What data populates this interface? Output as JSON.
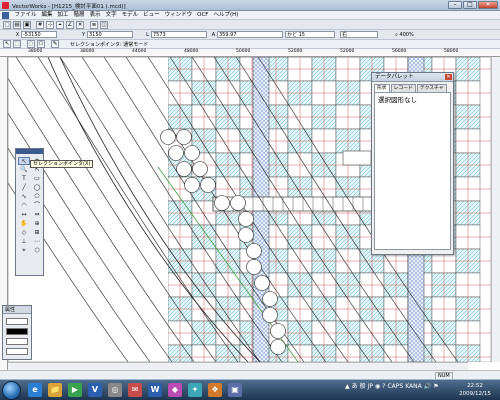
{
  "window": {
    "title": "VectorWorks - [H1215_検討平面01 (.mcd)]"
  },
  "menu": {
    "items": [
      "ファイル",
      "編集",
      "加工",
      "階層",
      "表示",
      "文字",
      "モデル",
      "ビュー",
      "ウィンドウ",
      "OCF",
      "ヘルプ(H)"
    ]
  },
  "coords": {
    "x_label": "X",
    "x_value": "-53150",
    "y_label": "Y",
    "y_value": "3150",
    "l_label": "L",
    "l_value": "7573",
    "a_label": "A",
    "a_value": "359.97",
    "snap_value": "かど 15",
    "direction_value": "右",
    "zoom_value": "400%"
  },
  "modebar": {
    "text": "セレクションポインタ: 通常モード"
  },
  "ruler": {
    "labels": [
      "38000",
      "38000",
      "44000",
      "48000",
      "50000",
      "52000",
      "52000",
      "56000",
      "58000"
    ]
  },
  "tooltip": {
    "text": "セレクションポインタ(X)"
  },
  "tool_palette": {
    "tools": [
      "↖",
      "+",
      "🔍",
      "⇱",
      "T",
      "▭",
      "╱",
      "◯",
      "∿",
      "⬠",
      "◠",
      "⌒",
      "↔",
      "⇔",
      "✋",
      "⊕",
      "◇",
      "⊞",
      "⊥",
      "⋯",
      "⌖",
      "⬡"
    ]
  },
  "attributes_palette": {
    "title": "属性"
  },
  "data_palette": {
    "title": "データパレット",
    "tabs": [
      "形状",
      "レコード",
      "テクスチャ"
    ],
    "content": "選択図形なし"
  },
  "status": {
    "num": "NUM"
  },
  "taskbar": {
    "apps": [
      "e",
      "📁",
      "▶",
      "V",
      "◎",
      "✉",
      "W",
      "◆",
      "✦",
      "❖",
      "▣"
    ],
    "tray": [
      "▲",
      "あ",
      "般",
      "JP",
      "◉",
      "?",
      "CAPS",
      "KANA",
      "🔊",
      "⚑"
    ],
    "time": "22:52",
    "date": "2009/12/15"
  },
  "colors": {
    "hatch_cyan": "#4fb7c4",
    "grid_red": "#d85a5a",
    "green_line": "#2c9a2c",
    "title_blue": "#3a5b8c"
  }
}
